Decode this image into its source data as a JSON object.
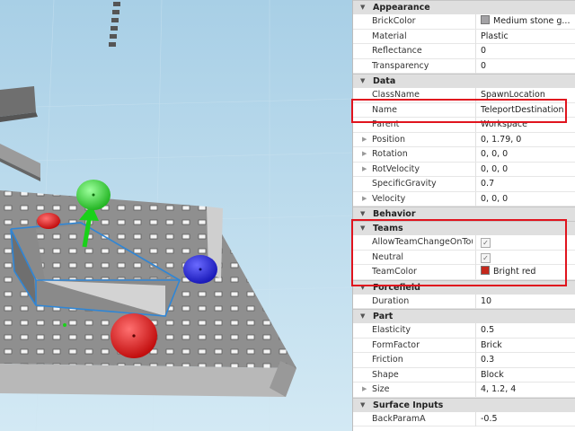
{
  "properties": {
    "categories": [
      {
        "name": "Appearance",
        "rows": [
          {
            "name": "BrickColor",
            "value": "Medium stone g...",
            "swatch": "#a3a2a5"
          },
          {
            "name": "Material",
            "value": "Plastic"
          },
          {
            "name": "Reflectance",
            "value": "0"
          },
          {
            "name": "Transparency",
            "value": "0"
          }
        ]
      },
      {
        "name": "Data",
        "rows": [
          {
            "name": "ClassName",
            "value": "SpawnLocation"
          },
          {
            "name": "Name",
            "value": "TeleportDestination"
          },
          {
            "name": "Parent",
            "value": "Workspace"
          },
          {
            "name": "Position",
            "value": "0, 1.79, 0",
            "expandable": true
          },
          {
            "name": "Rotation",
            "value": "0, 0, 0",
            "expandable": true
          },
          {
            "name": "RotVelocity",
            "value": "0, 0, 0",
            "expandable": true
          },
          {
            "name": "SpecificGravity",
            "value": "0.7"
          },
          {
            "name": "Velocity",
            "value": "0, 0, 0",
            "expandable": true
          }
        ]
      },
      {
        "name": "Behavior",
        "rows": []
      },
      {
        "name": "Teams",
        "rows": [
          {
            "name": "AllowTeamChangeOnTouch",
            "checkbox": true
          },
          {
            "name": "Neutral",
            "checkbox": true
          },
          {
            "name": "TeamColor",
            "value": "Bright red",
            "swatch": "#c4281c"
          }
        ]
      },
      {
        "name": "Forcefield",
        "rows": [
          {
            "name": "Duration",
            "value": "10"
          }
        ]
      },
      {
        "name": "Part",
        "rows": [
          {
            "name": "Elasticity",
            "value": "0.5"
          },
          {
            "name": "FormFactor",
            "value": "Brick"
          },
          {
            "name": "Friction",
            "value": "0.3"
          },
          {
            "name": "Shape",
            "value": "Block"
          },
          {
            "name": "Size",
            "value": "4, 1.2, 4",
            "expandable": true
          }
        ]
      },
      {
        "name": "Surface Inputs",
        "rows": [
          {
            "name": "BackParamA",
            "value": "-0.5"
          }
        ]
      }
    ]
  },
  "icons": {
    "collapse": "triangle-down-icon",
    "expand": "triangle-right-icon",
    "check": "checkmark-icon"
  },
  "colors": {
    "highlight": "#e0141e",
    "sky": "#b8d9ec",
    "selection": "#2f86d6"
  }
}
